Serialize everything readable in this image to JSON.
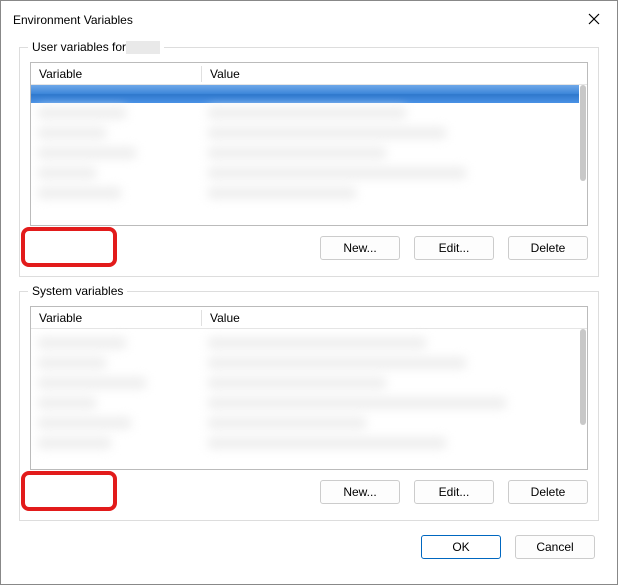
{
  "window": {
    "title": "Environment Variables"
  },
  "user_section": {
    "label_prefix": "User variables for",
    "columns": {
      "variable": "Variable",
      "value": "Value"
    },
    "buttons": {
      "new": "New...",
      "edit": "Edit...",
      "delete": "Delete"
    }
  },
  "system_section": {
    "label": "System variables",
    "columns": {
      "variable": "Variable",
      "value": "Value"
    },
    "buttons": {
      "new": "New...",
      "edit": "Edit...",
      "delete": "Delete"
    }
  },
  "dialog_buttons": {
    "ok": "OK",
    "cancel": "Cancel"
  }
}
